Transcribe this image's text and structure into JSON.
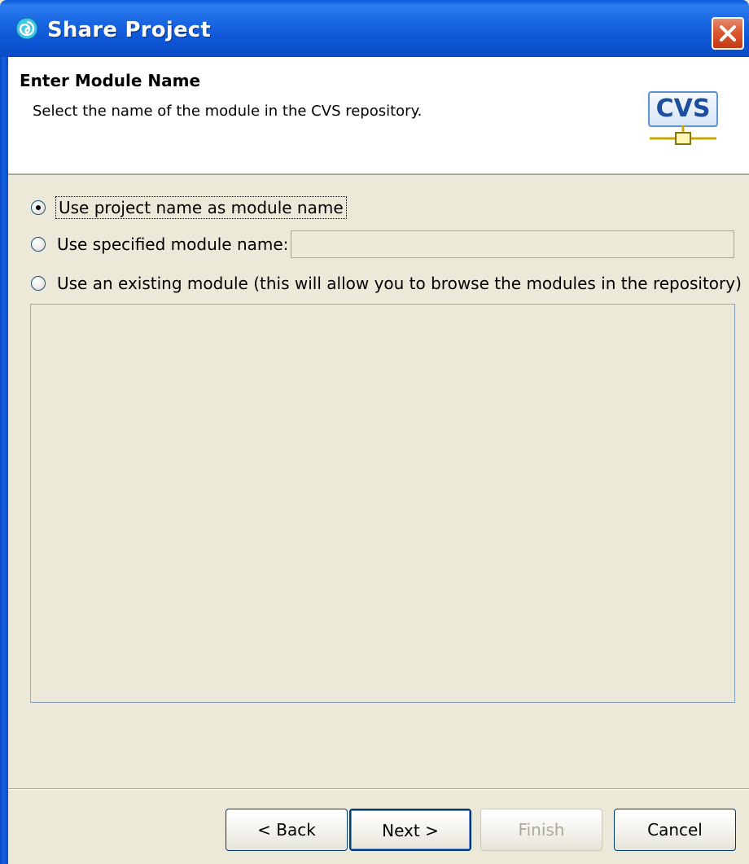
{
  "window": {
    "title": "Share Project",
    "app_icon": "eclipse-swirl-icon",
    "close_icon": "close-icon"
  },
  "header": {
    "title": "Enter Module Name",
    "description": "Select the name of the module in the CVS repository.",
    "logo_text": "CVS",
    "logo_icon": "cvs-repository-icon"
  },
  "options": {
    "selected": "project-name",
    "items": [
      {
        "id": "project-name",
        "label": "Use project name as module name",
        "checked": true
      },
      {
        "id": "specified-name",
        "label": "Use specified module name:",
        "checked": false
      },
      {
        "id": "existing-module",
        "label": "Use an existing module (this will allow you to browse the modules in the repository)",
        "checked": false
      }
    ]
  },
  "module_name_input": {
    "value": "",
    "enabled": false
  },
  "buttons": {
    "back": "< Back",
    "next": "Next >",
    "finish": "Finish",
    "cancel": "Cancel",
    "finish_enabled": false,
    "default": "next"
  },
  "colors": {
    "titlebar": "#0b51d0",
    "dialog_bg": "#ece9d8",
    "close_button": "#d9542b",
    "cvs_text": "#1e4f9e"
  }
}
